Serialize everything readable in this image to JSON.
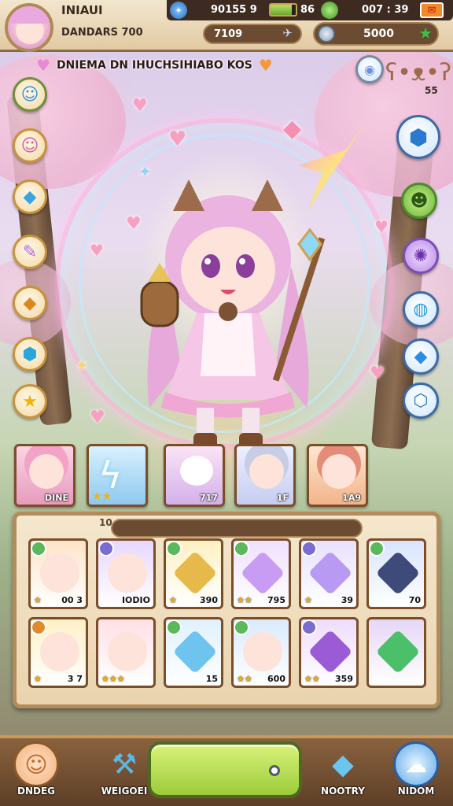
{
  "topbar": {
    "player_name": "INIAUI",
    "player_title": "DANDARS 700",
    "exp_value": "7109",
    "stat1_value": "90155 9",
    "stat2_value": "86",
    "timer_value": "007 : 39",
    "energy_level": 0.85,
    "gold_value": "5000",
    "icons": [
      "avatar-portrait",
      "globe-icon",
      "energy-bar-icon",
      "green-orb-icon",
      "mail-icon",
      "plane-icon",
      "coin-icon",
      "star-plus-icon"
    ]
  },
  "quest_banner": {
    "text": "DNIEMA DN IHUCHSIHIABO KOS"
  },
  "right_badge": "55",
  "left_menu": [
    "blue-hair-hero-icon",
    "pink-hair-hero-icon",
    "crystal-icon",
    "feather-wand-icon",
    "orange-gem-icon",
    "blue-gem-icon",
    "gold-star-icon"
  ],
  "right_menu": [
    "orb-icon",
    "teddy-bear-icon",
    "blue-crystal-icon",
    "green-creature-icon",
    "purple-rune-icon",
    "blue-orb-icon",
    "blue-diamond-icon",
    "sapphire-icon"
  ],
  "roster": [
    {
      "label": "DINE",
      "name": "pink-hair-girl"
    },
    {
      "label": "",
      "name": "lightning-crystal"
    },
    {
      "label": "717",
      "name": "white-mascot"
    },
    {
      "label": "1F",
      "name": "silver-hair-girl"
    },
    {
      "label": "1A9",
      "name": "headband-girl"
    }
  ],
  "inventory": {
    "page_num": "10",
    "cards": [
      {
        "label": "00 3",
        "name": "cat-ear-girl",
        "stars": "★",
        "gem": "#5cb85c"
      },
      {
        "label": "IODIO",
        "name": "purple-hair-girl",
        "stars": "",
        "gem": "#7b6ccf"
      },
      {
        "label": "390",
        "name": "golden-amulet",
        "stars": "★",
        "gem": "#5cb85c"
      },
      {
        "label": "795",
        "name": "purple-crystal",
        "stars": "★★",
        "gem": "#5cb85c"
      },
      {
        "label": "39",
        "name": "violet-shard",
        "stars": "★",
        "gem": "#7b6ccf"
      },
      {
        "label": "70",
        "name": "dark-knight",
        "stars": "",
        "gem": "#5cb85c"
      },
      {
        "label": "3 7",
        "name": "blonde-bow-girl",
        "stars": "★",
        "gem": "#e08a2a"
      },
      {
        "label": "",
        "name": "black-hair-girl",
        "stars": "★★★",
        "gem": ""
      },
      {
        "label": "15",
        "name": "water-drop",
        "stars": "",
        "gem": "#5cb85c"
      },
      {
        "label": "600",
        "name": "blue-hair-girl",
        "stars": "★★",
        "gem": "#5cb85c"
      },
      {
        "label": "359",
        "name": "magic-staff",
        "stars": "★★",
        "gem": "#7b6ccf"
      },
      {
        "label": "",
        "name": "emerald-box",
        "stars": "",
        "gem": ""
      }
    ]
  },
  "nav": {
    "item1": "DNDEG",
    "item2": "WEIGOEI",
    "item4": "NOOTRY",
    "item5": "NIDOM"
  }
}
